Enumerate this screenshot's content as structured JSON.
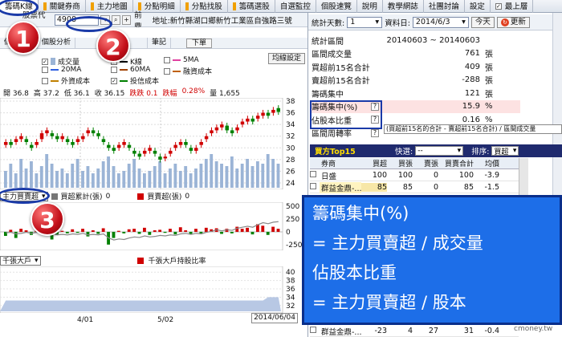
{
  "tabs": [
    {
      "label": "籌碼K線",
      "active": true
    },
    {
      "label": "關鍵券商",
      "active": false
    },
    {
      "label": "主力地圖",
      "active": false
    },
    {
      "label": "分點明細",
      "active": false
    },
    {
      "label": "分點找股",
      "active": false
    },
    {
      "label": "籌碼選股",
      "active": false
    },
    {
      "label": "自選監控",
      "active": false
    },
    {
      "label": "個股速覽",
      "active": false
    },
    {
      "label": "說明",
      "active": false
    },
    {
      "label": "教學網誌",
      "active": false
    },
    {
      "label": "社團討論",
      "active": false
    },
    {
      "label": "設定",
      "active": false
    },
    {
      "label": "最上層",
      "active": false
    }
  ],
  "stock": {
    "code_label": "股票代號:",
    "code": "4908",
    "name": "前鼎",
    "address": "地址:新竹縣湖口鄉新竹工業區自強路三號"
  },
  "subtabs": [
    "個股速覽",
    "個股分析",
    "",
    "筆記"
  ],
  "download_label": "下單",
  "settings_label": "均線設定",
  "legend": [
    {
      "label": "成交量",
      "checked": true,
      "color": "#9bb4d6"
    },
    {
      "label": "K線",
      "checked": true,
      "color": "#000000"
    },
    {
      "label": "5MA",
      "checked": false,
      "color": "#e040a0"
    },
    {
      "label": "20MA",
      "checked": false,
      "color": "#3060e0"
    },
    {
      "label": "60MA",
      "checked": false,
      "color": "#a04000"
    },
    {
      "label": "融資成本",
      "checked": false,
      "color": "#c06000"
    },
    {
      "label": "外資成本",
      "checked": false,
      "color": "#c08000"
    },
    {
      "label": "投信成本",
      "checked": true,
      "color": "#008000"
    }
  ],
  "info": {
    "open": "開 36.8",
    "high": "高 37.2",
    "low": "低 36.1",
    "close": "收 36.15",
    "change": "跌跌 0.1",
    "pct_label": "跌幅",
    "pct": "0.28%",
    "vol": "量 1,655"
  },
  "price_axis": [
    "38",
    "36",
    "34",
    "32",
    "30",
    "28",
    "26",
    "24"
  ],
  "indicator": {
    "select": "主力買賣超",
    "series1": "買超累計(張)",
    "series1_val": "0",
    "series2": "買賣超(張)",
    "series2_val": "0",
    "axis": [
      "500",
      "250",
      "0",
      "-250"
    ]
  },
  "lower": {
    "select": "千張大戶",
    "series": "千張大戶持股比率",
    "axis": [
      "40",
      "38",
      "36",
      "34",
      "32"
    ]
  },
  "x_axis": [
    "4/01",
    "5/02"
  ],
  "date_label": "2014/06/04",
  "right": {
    "days_label": "統計天數:",
    "days_value": "1",
    "date_label": "資料日:",
    "date_value": "2014/6/3",
    "today_btn": "今天",
    "update_btn": "更新"
  },
  "stats": [
    {
      "key": "統計區間",
      "value": "20140603 ~ 20140603",
      "unit": ""
    },
    {
      "key": "區間成交量",
      "value": "761",
      "unit": "張"
    },
    {
      "key": "買超前15名合計",
      "value": "409",
      "unit": "張"
    },
    {
      "key": "賣超前15名合計",
      "value": "-288",
      "unit": "張"
    },
    {
      "key": "籌碼集中",
      "value": "121",
      "unit": "張"
    },
    {
      "key": "籌碼集中(%)",
      "value": "15.9",
      "unit": "%"
    },
    {
      "key": "佔股本比重",
      "value": "0.16",
      "unit": "%"
    },
    {
      "key": "區間周轉率",
      "value": "",
      "unit": ""
    }
  ],
  "tooltip": "(買超前15名的合計 - 賣超前15名合計) / 區間成交量",
  "top15": {
    "title": "買方Top15",
    "quick_label": "快選:",
    "quick_value": "--",
    "sort_label": "排序:",
    "sort_value": "買超",
    "headers": [
      "",
      "券商",
      "買超",
      "買張",
      "賣張",
      "買賣合計",
      "均價"
    ],
    "rows": [
      {
        "broker": "日盛",
        "cells": [
          "100",
          "100",
          "0",
          "100",
          "-3.9"
        ]
      },
      {
        "broker": "群益金鼎-...",
        "cells": [
          "85",
          "85",
          "0",
          "85",
          "-1.5"
        ]
      }
    ],
    "bottom_row": {
      "broker": "群益金鼎-...",
      "cells": [
        "-23",
        "4",
        "27",
        "31",
        "-0.4"
      ]
    }
  },
  "overlay": {
    "line1": "籌碼集中(%)",
    "line2": "= 主力買賣超 / 成交量",
    "line3": "佔股本比重",
    "line4": "= 主力買賣超 / 股本"
  },
  "badges": [
    "1",
    "2",
    "3"
  ],
  "watermark": "cmoney.tw",
  "chart_data": {
    "type": "candlestick",
    "x_ticks": [
      "4/01",
      "5/02"
    ],
    "ylim": [
      24,
      38
    ],
    "y_ticks": [
      24,
      26,
      28,
      30,
      32,
      34,
      36,
      38
    ],
    "closes": [
      31,
      30.5,
      31.5,
      32,
      31,
      30,
      31,
      32.5,
      33,
      32,
      31.5,
      32,
      31,
      30.5,
      31.5,
      32,
      33,
      32.5,
      32,
      31,
      30,
      29.5,
      30.5,
      31,
      30,
      29,
      28.5,
      29.5,
      30,
      29,
      28,
      28.5,
      29.5,
      30.5,
      31,
      30.5,
      29.5,
      30,
      31,
      32,
      33,
      33.5,
      34,
      33,
      32.5,
      33.5,
      34.5,
      35,
      34.5,
      35.5,
      36,
      35.5,
      36.5,
      36.15
    ],
    "opens": [
      30.5,
      31,
      31,
      31.5,
      31.5,
      30.5,
      30.5,
      31.5,
      32.5,
      32.5,
      32,
      31.5,
      31.5,
      31,
      31,
      31.5,
      32.5,
      33,
      32.5,
      31.5,
      30.5,
      30,
      30,
      30.5,
      30.5,
      29.5,
      29,
      29,
      29.5,
      29.5,
      28.5,
      28.2,
      29,
      30,
      30.5,
      31,
      30,
      29.5,
      30.5,
      31.5,
      32.5,
      33,
      33.5,
      33.8,
      33,
      33,
      34,
      34.5,
      35,
      35,
      35.5,
      36,
      36,
      36.8
    ],
    "volume_pct": [
      0.35,
      0.5,
      0.3,
      0.6,
      0.4,
      0.55,
      0.3,
      0.45,
      0.7,
      0.5,
      0.35,
      0.4,
      0.3,
      0.5,
      0.6,
      0.35,
      0.45,
      0.3,
      0.4,
      0.55,
      0.65,
      0.45,
      0.3,
      0.35,
      0.5,
      0.6,
      0.4,
      0.3,
      0.35,
      0.45,
      0.55,
      0.3,
      0.4,
      0.5,
      0.35,
      0.45,
      0.3,
      0.4,
      0.5,
      0.6,
      0.7,
      0.55,
      0.5,
      0.45,
      0.65,
      0.4,
      0.5,
      0.6,
      0.45,
      0.55,
      0.5,
      0.7,
      0.6,
      0.5
    ],
    "indicator": [
      -80,
      40,
      -120,
      60,
      30,
      -60,
      80,
      -40,
      90,
      -150,
      -60,
      20,
      -30,
      50,
      -20,
      60,
      -90,
      30,
      -40,
      70,
      -250,
      -120,
      20,
      -30,
      50,
      60,
      -40,
      80,
      -60,
      30,
      40,
      -20,
      60,
      -50,
      90,
      30,
      -40,
      60,
      -30,
      80,
      50,
      70,
      -40,
      60,
      -30,
      100,
      60,
      80,
      -50,
      150,
      120,
      -60,
      100,
      60
    ],
    "indicator_line": [
      -20,
      -10,
      -40,
      -30,
      -10,
      -30,
      -10,
      -20,
      0,
      -40,
      -60,
      -50,
      -60,
      -40,
      -50,
      -30,
      -60,
      -50,
      -60,
      -40,
      -120,
      -160,
      -140,
      -150,
      -120,
      -100,
      -110,
      -80,
      -100,
      -90,
      -70,
      -80,
      -60,
      -70,
      -40,
      -30,
      -50,
      -30,
      -40,
      -10,
      10,
      40,
      20,
      40,
      30,
      70,
      90,
      110,
      90,
      140,
      180,
      160,
      190,
      200
    ],
    "lower_line": [
      33.2,
      33.2,
      33.2,
      33.2,
      33.2,
      33.2,
      33.2,
      33.2,
      33.2,
      33.2,
      33.2,
      33.2,
      33.2,
      33.2,
      33.2,
      33.2,
      33.2,
      33.2,
      33.2,
      33.2,
      33.2,
      33.2,
      33.2,
      33.2,
      33.2,
      33.2,
      33.2,
      33.2,
      33.2,
      33.2,
      33.2,
      33.2,
      33.2,
      33.2,
      33.2,
      33.2,
      33.2,
      33.2,
      33.2,
      33.2,
      33.2,
      33.2,
      33.2,
      33.2,
      33.2,
      33.2,
      33.2,
      33.2,
      33.2,
      33.2,
      33.2,
      34,
      34,
      34
    ]
  }
}
